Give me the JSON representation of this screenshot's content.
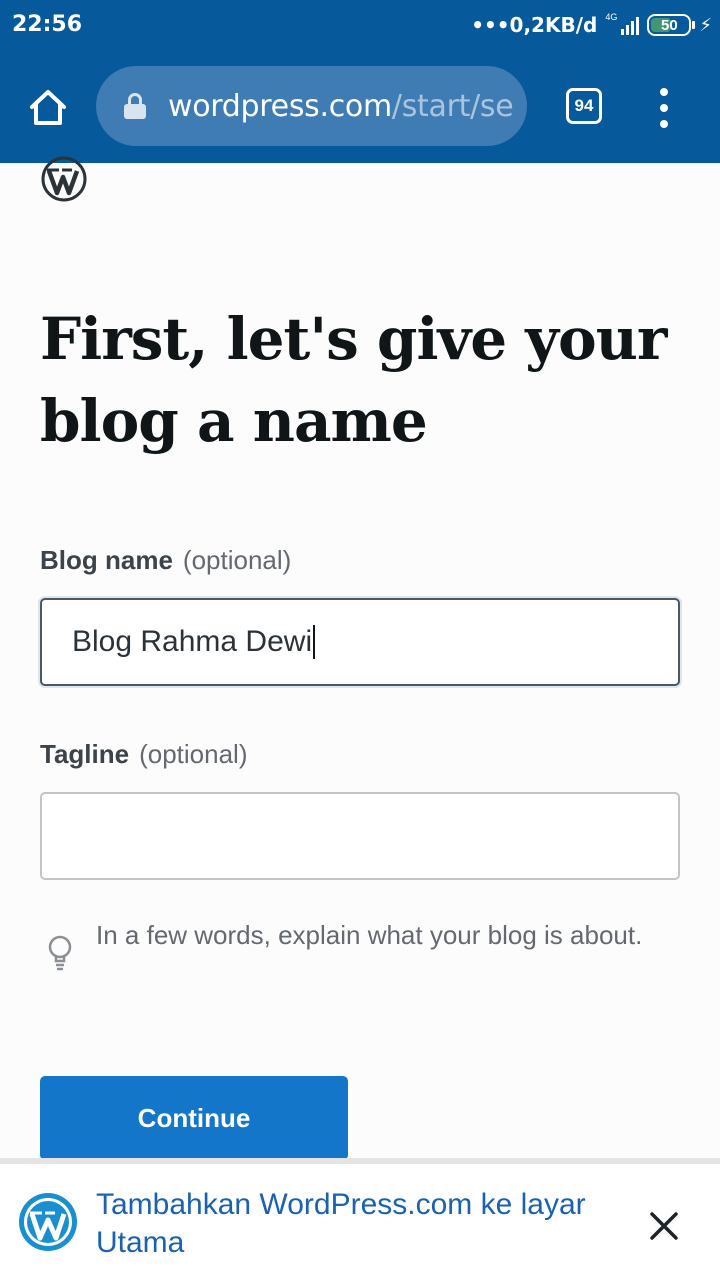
{
  "status_bar": {
    "time": "22:56",
    "network_speed": "•••0,2KB/d",
    "network_type": "4G",
    "battery": "50"
  },
  "browser": {
    "url_domain": "wordpress.com",
    "url_path": "/start/se",
    "tab_count": "94"
  },
  "page": {
    "headline": "First, let's give your blog a name",
    "blog_name_label": "Blog name",
    "blog_name_optional": "(optional)",
    "blog_name_value": "Blog Rahma Dewi",
    "tagline_label": "Tagline",
    "tagline_optional": "(optional)",
    "tagline_value": "",
    "tagline_hint": "In a few words, explain what your blog is about.",
    "continue_label": "Continue"
  },
  "install_banner": {
    "text": "Tambahkan WordPress.com ke layar Utama"
  },
  "icons": {
    "home": "home-icon",
    "lock": "lock-icon",
    "menu": "more-vert-icon",
    "logo": "wordpress-logo-icon",
    "hint": "lightbulb-icon",
    "close": "close-icon"
  },
  "colors": {
    "browser_bar": "#06599b",
    "primary_button": "#1376c8",
    "banner_text": "#1a62b0"
  }
}
